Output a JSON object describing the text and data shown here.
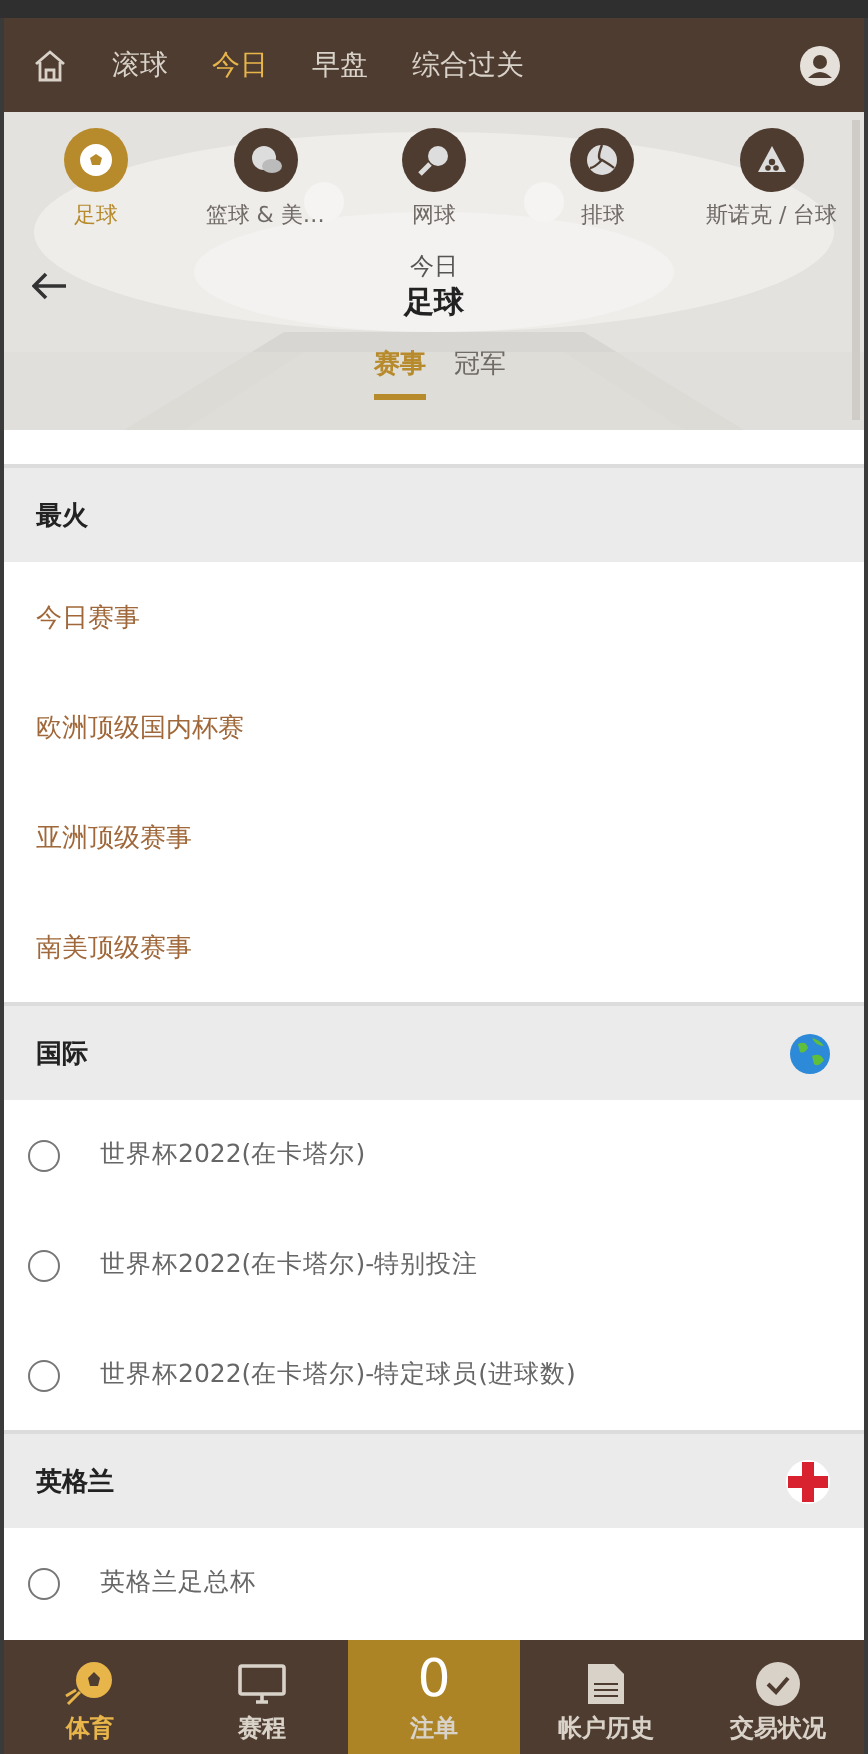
{
  "top_nav": {
    "tabs": [
      {
        "label": "滚球",
        "selected": false
      },
      {
        "label": "今日",
        "selected": true
      },
      {
        "label": "早盘",
        "selected": false
      },
      {
        "label": "综合过关",
        "selected": false
      }
    ]
  },
  "sports": [
    {
      "label": "足球",
      "kind": "soccer",
      "selected": true
    },
    {
      "label": "篮球 & 美…",
      "kind": "basketball",
      "selected": false
    },
    {
      "label": "网球",
      "kind": "tennis",
      "selected": false
    },
    {
      "label": "排球",
      "kind": "volleyball",
      "selected": false
    },
    {
      "label": "斯诺克 / 台球",
      "kind": "snooker",
      "selected": false
    }
  ],
  "header": {
    "subtitle": "今日",
    "title": "足球"
  },
  "sub_tabs": [
    {
      "label": "赛事",
      "selected": true
    },
    {
      "label": "冠军",
      "selected": false
    }
  ],
  "sections": [
    {
      "title": "最火",
      "kind": "plain",
      "items": [
        {
          "kind": "link",
          "label": "今日赛事"
        },
        {
          "kind": "link",
          "label": "欧洲顶级国内杯赛"
        },
        {
          "kind": "link",
          "label": "亚洲顶级赛事"
        },
        {
          "kind": "link",
          "label": "南美顶级赛事"
        }
      ]
    },
    {
      "title": "国际",
      "kind": "globe",
      "items": [
        {
          "kind": "radio",
          "label": "世界杯2022(在卡塔尔)",
          "checked": false
        },
        {
          "kind": "radio",
          "label": "世界杯2022(在卡塔尔)-特别投注",
          "checked": false
        },
        {
          "kind": "radio",
          "label": "世界杯2022(在卡塔尔)-特定球员(进球数)",
          "checked": false
        }
      ]
    },
    {
      "title": "英格兰",
      "kind": "flag",
      "items": [
        {
          "kind": "radio",
          "label": "英格兰足总杯",
          "checked": false
        }
      ]
    }
  ],
  "bottom_nav": [
    {
      "label": "体育",
      "kind": "sports",
      "selected": true
    },
    {
      "label": "赛程",
      "kind": "monitor",
      "selected": false
    },
    {
      "label": "注单",
      "kind": "count",
      "count": "0",
      "selected": false
    },
    {
      "label": "帐户历史",
      "kind": "document",
      "selected": false
    },
    {
      "label": "交易状况",
      "kind": "check",
      "selected": false
    }
  ]
}
